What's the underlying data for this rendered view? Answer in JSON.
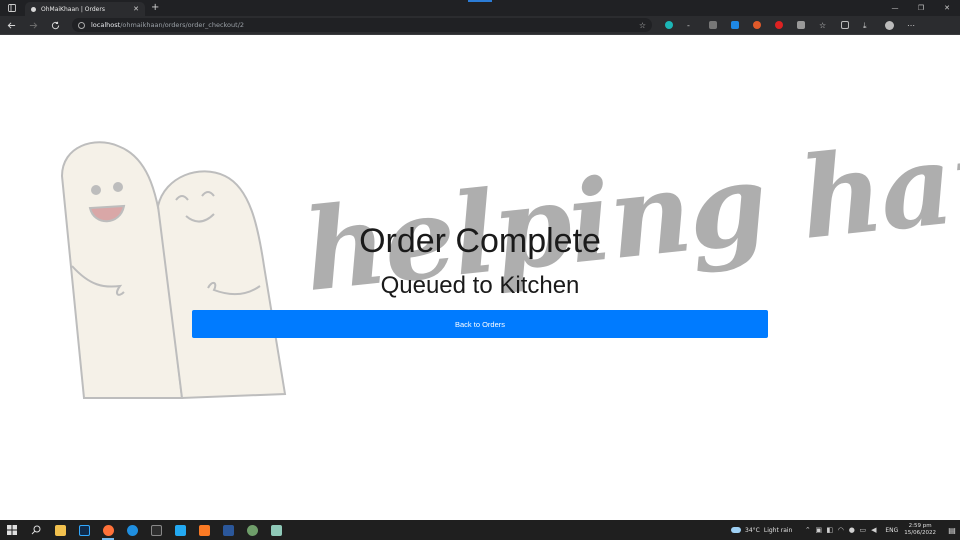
{
  "browser": {
    "tab_title": "OhMaiKhaan | Orders",
    "tab_close": "✕",
    "new_tab": "+",
    "url_host": "localhost",
    "url_path": "/ohmaikhaan/orders/order_checkout/2",
    "window_controls": {
      "minimize": "—",
      "maximize": "❐",
      "close": "✕"
    }
  },
  "page": {
    "logo_text": "helping hand",
    "title": "Order Complete",
    "subtitle": "Queued to Kitchen",
    "back_button": "Back to Orders",
    "button_color": "#007bff"
  },
  "taskbar": {
    "weather_temp": "34°C",
    "weather_desc": "Light rain",
    "language": "ENG",
    "time": "2:59 pm",
    "date": "15/06/2022"
  }
}
